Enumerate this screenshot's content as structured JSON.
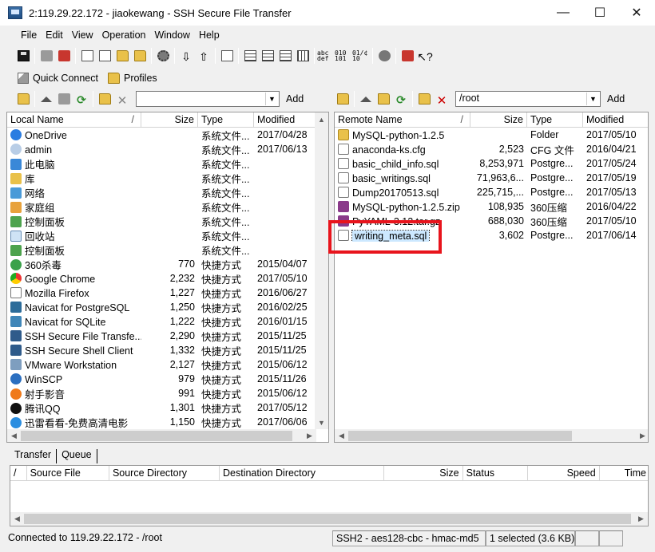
{
  "window": {
    "title": "2:119.29.22.172 - jiaokewang - SSH Secure File Transfer",
    "minimize": "—",
    "maximize": "☐",
    "close": "✕"
  },
  "menu": [
    "File",
    "Edit",
    "View",
    "Operation",
    "Window",
    "Help"
  ],
  "quick_toolbar": {
    "quick_connect": "Quick Connect",
    "profiles": "Profiles"
  },
  "toolbar_text_icons": {
    "abc_def": "abc def",
    "bin_010": "010 101",
    "auto": "01/¢ 10"
  },
  "local": {
    "path": "",
    "add_label": "Add",
    "columns": [
      "Local Name",
      "Size",
      "Type",
      "Modified"
    ],
    "rows": [
      {
        "name": "OneDrive",
        "size": "",
        "type": "系统文件...",
        "modified": "2017/04/28",
        "icon": "cloud-icon"
      },
      {
        "name": "admin",
        "size": "",
        "type": "系统文件...",
        "modified": "2017/06/13",
        "icon": "user-icon"
      },
      {
        "name": "此电脑",
        "size": "",
        "type": "系统文件...",
        "modified": "",
        "icon": "computer-icon"
      },
      {
        "name": "库",
        "size": "",
        "type": "系统文件...",
        "modified": "",
        "icon": "library-icon"
      },
      {
        "name": "网络",
        "size": "",
        "type": "系统文件...",
        "modified": "",
        "icon": "network-icon"
      },
      {
        "name": "家庭组",
        "size": "",
        "type": "系统文件...",
        "modified": "",
        "icon": "homegroup-icon"
      },
      {
        "name": "控制面板",
        "size": "",
        "type": "系统文件...",
        "modified": "",
        "icon": "control-panel-icon"
      },
      {
        "name": "回收站",
        "size": "",
        "type": "系统文件...",
        "modified": "",
        "icon": "recycle-bin-icon"
      },
      {
        "name": "控制面板",
        "size": "",
        "type": "系统文件...",
        "modified": "",
        "icon": "control-panel-icon"
      },
      {
        "name": "360杀毒",
        "size": "770",
        "type": "快捷方式",
        "modified": "2015/04/07",
        "icon": "360-icon"
      },
      {
        "name": "Google Chrome",
        "size": "2,232",
        "type": "快捷方式",
        "modified": "2017/05/10",
        "icon": "chrome-icon"
      },
      {
        "name": "Mozilla Firefox",
        "size": "1,227",
        "type": "快捷方式",
        "modified": "2016/06/27",
        "icon": "shortcut-icon"
      },
      {
        "name": "Navicat for PostgreSQL",
        "size": "1,250",
        "type": "快捷方式",
        "modified": "2016/02/25",
        "icon": "navicat-postgres-icon"
      },
      {
        "name": "Navicat for SQLite",
        "size": "1,222",
        "type": "快捷方式",
        "modified": "2016/01/15",
        "icon": "navicat-sqlite-icon"
      },
      {
        "name": "SSH Secure File Transfe...",
        "size": "2,290",
        "type": "快捷方式",
        "modified": "2015/11/25",
        "icon": "ssh-icon"
      },
      {
        "name": "SSH Secure Shell Client",
        "size": "1,332",
        "type": "快捷方式",
        "modified": "2015/11/25",
        "icon": "ssh-icon"
      },
      {
        "name": "VMware Workstation",
        "size": "2,127",
        "type": "快捷方式",
        "modified": "2015/06/12",
        "icon": "vmware-icon"
      },
      {
        "name": "WinSCP",
        "size": "979",
        "type": "快捷方式",
        "modified": "2015/11/26",
        "icon": "winscp-icon"
      },
      {
        "name": "射手影音",
        "size": "991",
        "type": "快捷方式",
        "modified": "2015/06/12",
        "icon": "player-icon"
      },
      {
        "name": "腾讯QQ",
        "size": "1,301",
        "type": "快捷方式",
        "modified": "2017/05/12",
        "icon": "qq-icon"
      },
      {
        "name": "迅雷看看-免费高清电影",
        "size": "1,150",
        "type": "快捷方式",
        "modified": "2017/06/06",
        "icon": "xunlei-icon"
      }
    ]
  },
  "remote": {
    "path": "/root",
    "add_label": "Add",
    "columns": [
      "Remote Name",
      "Size",
      "Type",
      "Modified"
    ],
    "rows": [
      {
        "name": "MySQL-python-1.2.5",
        "size": "",
        "type": "Folder",
        "modified": "2017/05/10",
        "icon": "folder-icon"
      },
      {
        "name": "anaconda-ks.cfg",
        "size": "2,523",
        "type": "CFG 文件",
        "modified": "2016/04/21",
        "icon": "file-icon"
      },
      {
        "name": "basic_child_info.sql",
        "size": "8,253,971",
        "type": "Postgre...",
        "modified": "2017/05/24",
        "icon": "file-icon"
      },
      {
        "name": "basic_writings.sql",
        "size": "71,963,6...",
        "type": "Postgre...",
        "modified": "2017/05/19",
        "icon": "file-icon"
      },
      {
        "name": "Dump20170513.sql",
        "size": "225,715,...",
        "type": "Postgre...",
        "modified": "2017/05/13",
        "icon": "file-icon"
      },
      {
        "name": "MySQL-python-1.2.5.zip",
        "size": "108,935",
        "type": "360压缩",
        "modified": "2016/04/22",
        "icon": "zip-icon"
      },
      {
        "name": "PyYAML-3.12.tar.gz",
        "size": "688,030",
        "type": "360压缩",
        "modified": "2017/05/10",
        "icon": "zip-icon"
      },
      {
        "name": "writing_meta.sql",
        "size": "3,602",
        "type": "Postgre...",
        "modified": "2017/06/14",
        "icon": "file-icon",
        "selected": true
      }
    ]
  },
  "transfer": {
    "tabs": [
      "Transfer",
      "Queue"
    ],
    "columns": [
      "/",
      "Source File",
      "Source Directory",
      "Destination Directory",
      "Size",
      "Status",
      "Speed",
      "Time"
    ]
  },
  "status_bar": {
    "connection": "Connected to 119.29.22.172 - /root",
    "cipher": "SSH2 - aes128-cbc - hmac-md5",
    "selection": "1 selected (3.6 KB)"
  },
  "colors": {
    "highlight_box": "#e8141c",
    "selection_bg": "#cce8ff"
  }
}
